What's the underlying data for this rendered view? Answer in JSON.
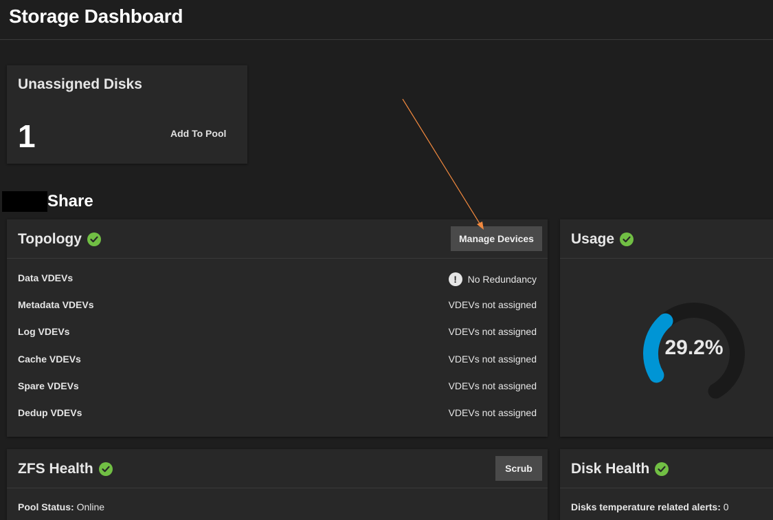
{
  "page": {
    "title": "Storage Dashboard"
  },
  "unassigned": {
    "title": "Unassigned Disks",
    "count": "1",
    "add_label": "Add To Pool"
  },
  "pool": {
    "name": "Share"
  },
  "topology": {
    "title": "Topology",
    "manage_label": "Manage Devices",
    "rows": [
      {
        "label": "Data VDEVs",
        "value": "No Redundancy"
      },
      {
        "label": "Metadata VDEVs",
        "value": "VDEVs not assigned"
      },
      {
        "label": "Log VDEVs",
        "value": "VDEVs not assigned"
      },
      {
        "label": "Cache VDEVs",
        "value": "VDEVs not assigned"
      },
      {
        "label": "Spare VDEVs",
        "value": "VDEVs not assigned"
      },
      {
        "label": "Dedup VDEVs",
        "value": "VDEVs not assigned"
      }
    ]
  },
  "usage": {
    "title": "Usage",
    "percent_text": "29.2%",
    "percent": 29.2,
    "fill_color": "#0095d5",
    "track_color": "#1a1a1a"
  },
  "zfs": {
    "title": "ZFS Health",
    "scrub_label": "Scrub",
    "status_label": "Pool Status:",
    "status_value": "Online"
  },
  "disk": {
    "title": "Disk Health",
    "alerts_label": "Disks temperature related alerts:",
    "alerts_value": "0"
  },
  "colors": {
    "ok": "#71bf44",
    "accent": "#0095d5",
    "annotation": "#f0883e"
  },
  "icons": {
    "ok": "check-circle-icon",
    "warning": "exclamation-icon"
  }
}
